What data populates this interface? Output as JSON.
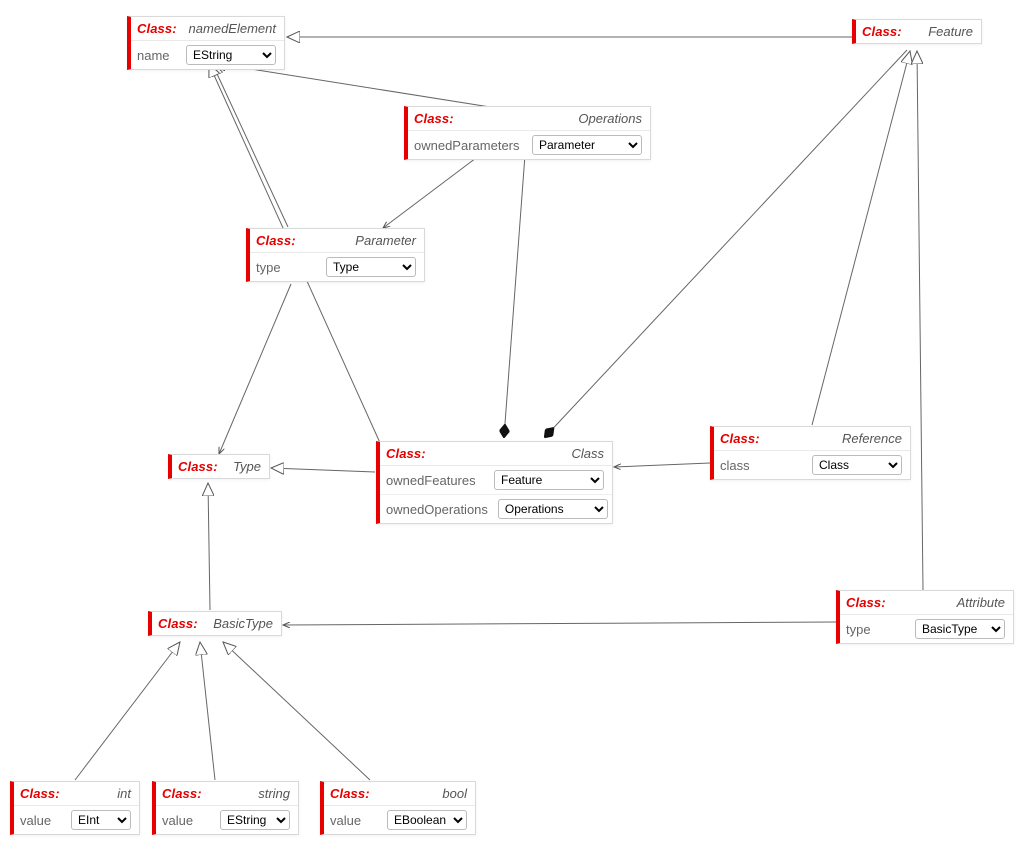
{
  "labels": {
    "class": "Class:"
  },
  "classes": {
    "namedElement": {
      "name": "namedElement",
      "attrs": [
        {
          "name": "name",
          "value": "EString"
        }
      ]
    },
    "feature": {
      "name": "Feature",
      "attrs": []
    },
    "operations": {
      "name": "Operations",
      "attrs": [
        {
          "name": "ownedParameters",
          "value": "Parameter"
        }
      ]
    },
    "parameter": {
      "name": "Parameter",
      "attrs": [
        {
          "name": "type",
          "value": "Type"
        }
      ]
    },
    "type": {
      "name": "Type",
      "attrs": []
    },
    "reference": {
      "name": "Reference",
      "attrs": [
        {
          "name": "class",
          "value": "Class"
        }
      ]
    },
    "classClass": {
      "name": "Class",
      "attrs": [
        {
          "name": "ownedFeatures",
          "value": "Feature"
        },
        {
          "name": "ownedOperations",
          "value": "Operations"
        }
      ]
    },
    "attribute": {
      "name": "Attribute",
      "attrs": [
        {
          "name": "type",
          "value": "BasicType"
        }
      ]
    },
    "basicType": {
      "name": "BasicType",
      "attrs": []
    },
    "int": {
      "name": "int",
      "attrs": [
        {
          "name": "value",
          "value": "EInt"
        }
      ]
    },
    "string": {
      "name": "string",
      "attrs": [
        {
          "name": "value",
          "value": "EString"
        }
      ]
    },
    "bool": {
      "name": "bool",
      "attrs": [
        {
          "name": "value",
          "value": "EBoolean"
        }
      ]
    }
  },
  "selectOptions": {
    "types": [
      "EString",
      "EInt",
      "EBoolean",
      "Type",
      "Parameter",
      "Feature",
      "Class",
      "Operations",
      "BasicType"
    ]
  },
  "diagram": {
    "edges": [
      {
        "from": "operations",
        "to": "namedElement",
        "kind": "inherit"
      },
      {
        "from": "feature",
        "to": "namedElement",
        "kind": "inherit"
      },
      {
        "from": "operations",
        "to": "parameter",
        "kind": "assoc"
      },
      {
        "from": "operations",
        "to": "classClass",
        "kind": "composition"
      },
      {
        "from": "feature",
        "to": "classClass",
        "kind": "composition"
      },
      {
        "from": "parameter",
        "to": "type",
        "kind": "assoc"
      },
      {
        "from": "classClass",
        "to": "type",
        "kind": "inherit"
      },
      {
        "from": "reference",
        "to": "classClass",
        "kind": "assoc"
      },
      {
        "from": "reference",
        "to": "feature",
        "kind": "inherit"
      },
      {
        "from": "attribute",
        "to": "feature",
        "kind": "inherit"
      },
      {
        "from": "attribute",
        "to": "basicType",
        "kind": "assoc"
      },
      {
        "from": "basicType",
        "to": "type",
        "kind": "inherit"
      },
      {
        "from": "int",
        "to": "basicType",
        "kind": "inherit"
      },
      {
        "from": "string",
        "to": "basicType",
        "kind": "inherit"
      },
      {
        "from": "bool",
        "to": "basicType",
        "kind": "inherit"
      }
    ]
  }
}
